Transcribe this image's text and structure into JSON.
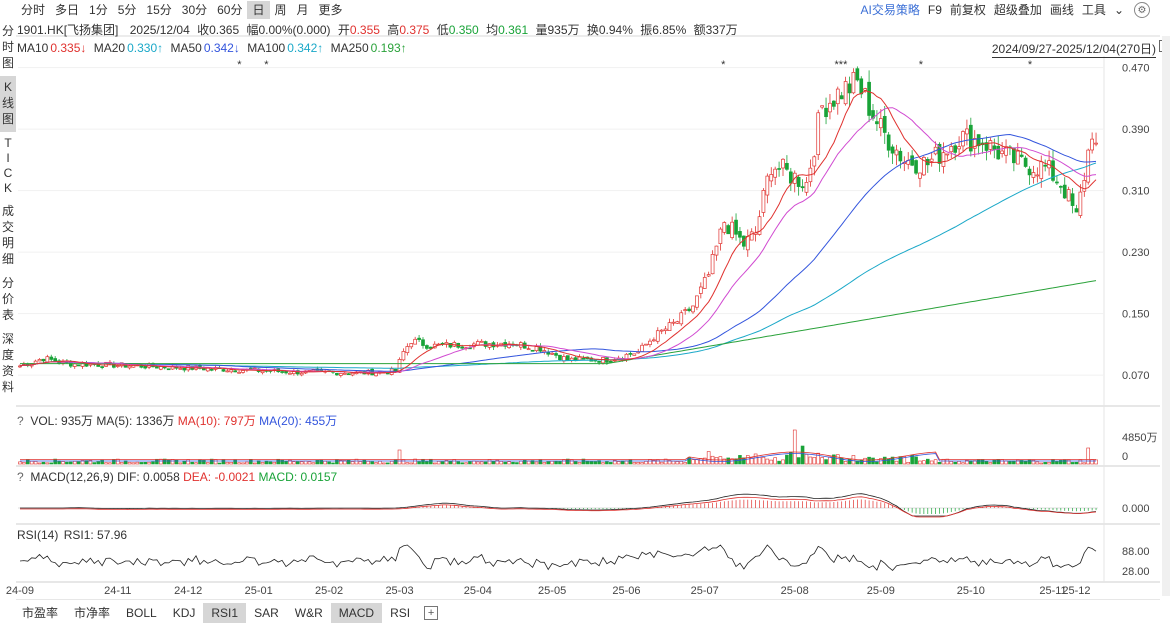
{
  "toolbar": {
    "periods": [
      "分时",
      "多日",
      "1分",
      "5分",
      "15分",
      "30分",
      "60分",
      "日",
      "周",
      "月",
      "更多"
    ],
    "active_period": "日",
    "tools": [
      "AI交易策略",
      "F9",
      "前复权",
      "超级叠加",
      "画线",
      "工具"
    ]
  },
  "left_tabs": [
    "分时图",
    "K线图",
    "TICK",
    "成交明细",
    "分价表",
    "深度资料"
  ],
  "active_left_tab": "K线图",
  "quote": {
    "code_name": "1901.HK[飞扬集团]",
    "date": "2025/12/04",
    "close": "收0.365",
    "change": "幅0.00%(0.000)",
    "open_label": "开",
    "open": "0.355",
    "high_label": "高",
    "high": "0.375",
    "low_label": "低",
    "low": "0.350",
    "avg_label": "均",
    "avg": "0.361",
    "volume": "量935万",
    "turnover": "换0.94%",
    "amplitude": "振6.85%",
    "amount": "额337万"
  },
  "ma_line": {
    "ma10_label": "MA10",
    "ma10": "0.335↓",
    "ma20_label": "MA20",
    "ma20": "0.330↑",
    "ma50_label": "MA50",
    "ma50": "0.342↓",
    "ma100_label": "MA100",
    "ma100": "0.342↑",
    "ma250_label": "MA250",
    "ma250": "0.193↑"
  },
  "range": "2024/09/27-2025/12/04(270日)",
  "vol_header": {
    "q": "?",
    "vol": "VOL: 935万",
    "ma5": "MA(5): 1336万",
    "ma10": "MA(10): 797万",
    "ma20": "MA(20): 455万"
  },
  "macd_header": {
    "q": "?",
    "name": "MACD(12,26,9)",
    "dif": "DIF: 0.0058",
    "dea": "DEA: -0.0021",
    "macd": "MACD: 0.0157"
  },
  "rsi_header": {
    "name": "RSI(14)",
    "rsi1": "RSI1: 57.96"
  },
  "bottom_tabs": [
    "市盈率",
    "市净率",
    "BOLL",
    "KDJ",
    "RSI1",
    "SAR",
    "W&R",
    "MACD",
    "RSI"
  ],
  "active_bottom_tabs": [
    "RSI1",
    "MACD"
  ],
  "colors": {
    "up": "#e0322f",
    "down": "#19a338",
    "ma10": "#e0322f",
    "ma20": "#d14bd1",
    "ma50": "#3355dd",
    "ma100": "#1aa8c8",
    "ma250": "#2aa23a"
  },
  "chart_data": {
    "type": "candlestick",
    "price_axis": {
      "ticks": [
        "0.470",
        "0.390",
        "0.310",
        "0.230",
        "0.150",
        "0.070"
      ],
      "values": [
        0.47,
        0.39,
        0.31,
        0.23,
        0.15,
        0.07
      ],
      "ylim": [
        0.035,
        0.48
      ]
    },
    "volume_axis": {
      "ticks": [
        "4850万",
        "0"
      ]
    },
    "macd_axis": {
      "ticks": [
        "0.000"
      ]
    },
    "rsi_axis": {
      "ticks": [
        "88.00",
        "28.00"
      ]
    },
    "x_ticks": [
      "24-09",
      "24-11",
      "24-12",
      "25-01",
      "25-02",
      "25-03",
      "25-04",
      "25-05",
      "25-06",
      "25-07",
      "25-08",
      "25-09",
      "25-10",
      "25-11",
      "25-12"
    ],
    "x_tick_index": [
      0,
      25,
      43,
      61,
      79,
      97,
      117,
      136,
      155,
      175,
      198,
      220,
      243,
      264,
      270
    ],
    "markers": [
      [
        "*",
        0.205
      ],
      [
        "*",
        0.23
      ],
      [
        "*",
        0.653
      ],
      [
        "***",
        0.762
      ],
      [
        "*",
        0.836
      ],
      [
        "*",
        0.937
      ]
    ],
    "close_keyframes": [
      [
        0,
        0.082
      ],
      [
        6,
        0.092
      ],
      [
        12,
        0.085
      ],
      [
        30,
        0.082
      ],
      [
        50,
        0.078
      ],
      [
        70,
        0.074
      ],
      [
        88,
        0.073
      ],
      [
        96,
        0.075
      ],
      [
        98,
        0.1
      ],
      [
        100,
        0.115
      ],
      [
        105,
        0.108
      ],
      [
        115,
        0.11
      ],
      [
        125,
        0.112
      ],
      [
        133,
        0.105
      ],
      [
        140,
        0.09
      ],
      [
        150,
        0.09
      ],
      [
        158,
        0.1
      ],
      [
        162,
        0.12
      ],
      [
        168,
        0.14
      ],
      [
        172,
        0.16
      ],
      [
        176,
        0.2
      ],
      [
        180,
        0.27
      ],
      [
        185,
        0.24
      ],
      [
        188,
        0.255
      ],
      [
        192,
        0.345
      ],
      [
        197,
        0.33
      ],
      [
        201,
        0.32
      ],
      [
        205,
        0.42
      ],
      [
        210,
        0.44
      ],
      [
        214,
        0.45
      ],
      [
        220,
        0.39
      ],
      [
        226,
        0.35
      ],
      [
        232,
        0.345
      ],
      [
        240,
        0.38
      ],
      [
        246,
        0.375
      ],
      [
        250,
        0.36
      ],
      [
        256,
        0.345
      ],
      [
        262,
        0.34
      ],
      [
        266,
        0.32
      ],
      [
        268,
        0.3
      ],
      [
        270,
        0.275
      ],
      [
        272,
        0.33
      ],
      [
        274,
        0.39
      ],
      [
        275,
        0.365
      ]
    ],
    "ma_final": {
      "ma10": 0.335,
      "ma20": 0.33,
      "ma50": 0.342,
      "ma100": 0.342,
      "ma250": 0.193
    }
  }
}
